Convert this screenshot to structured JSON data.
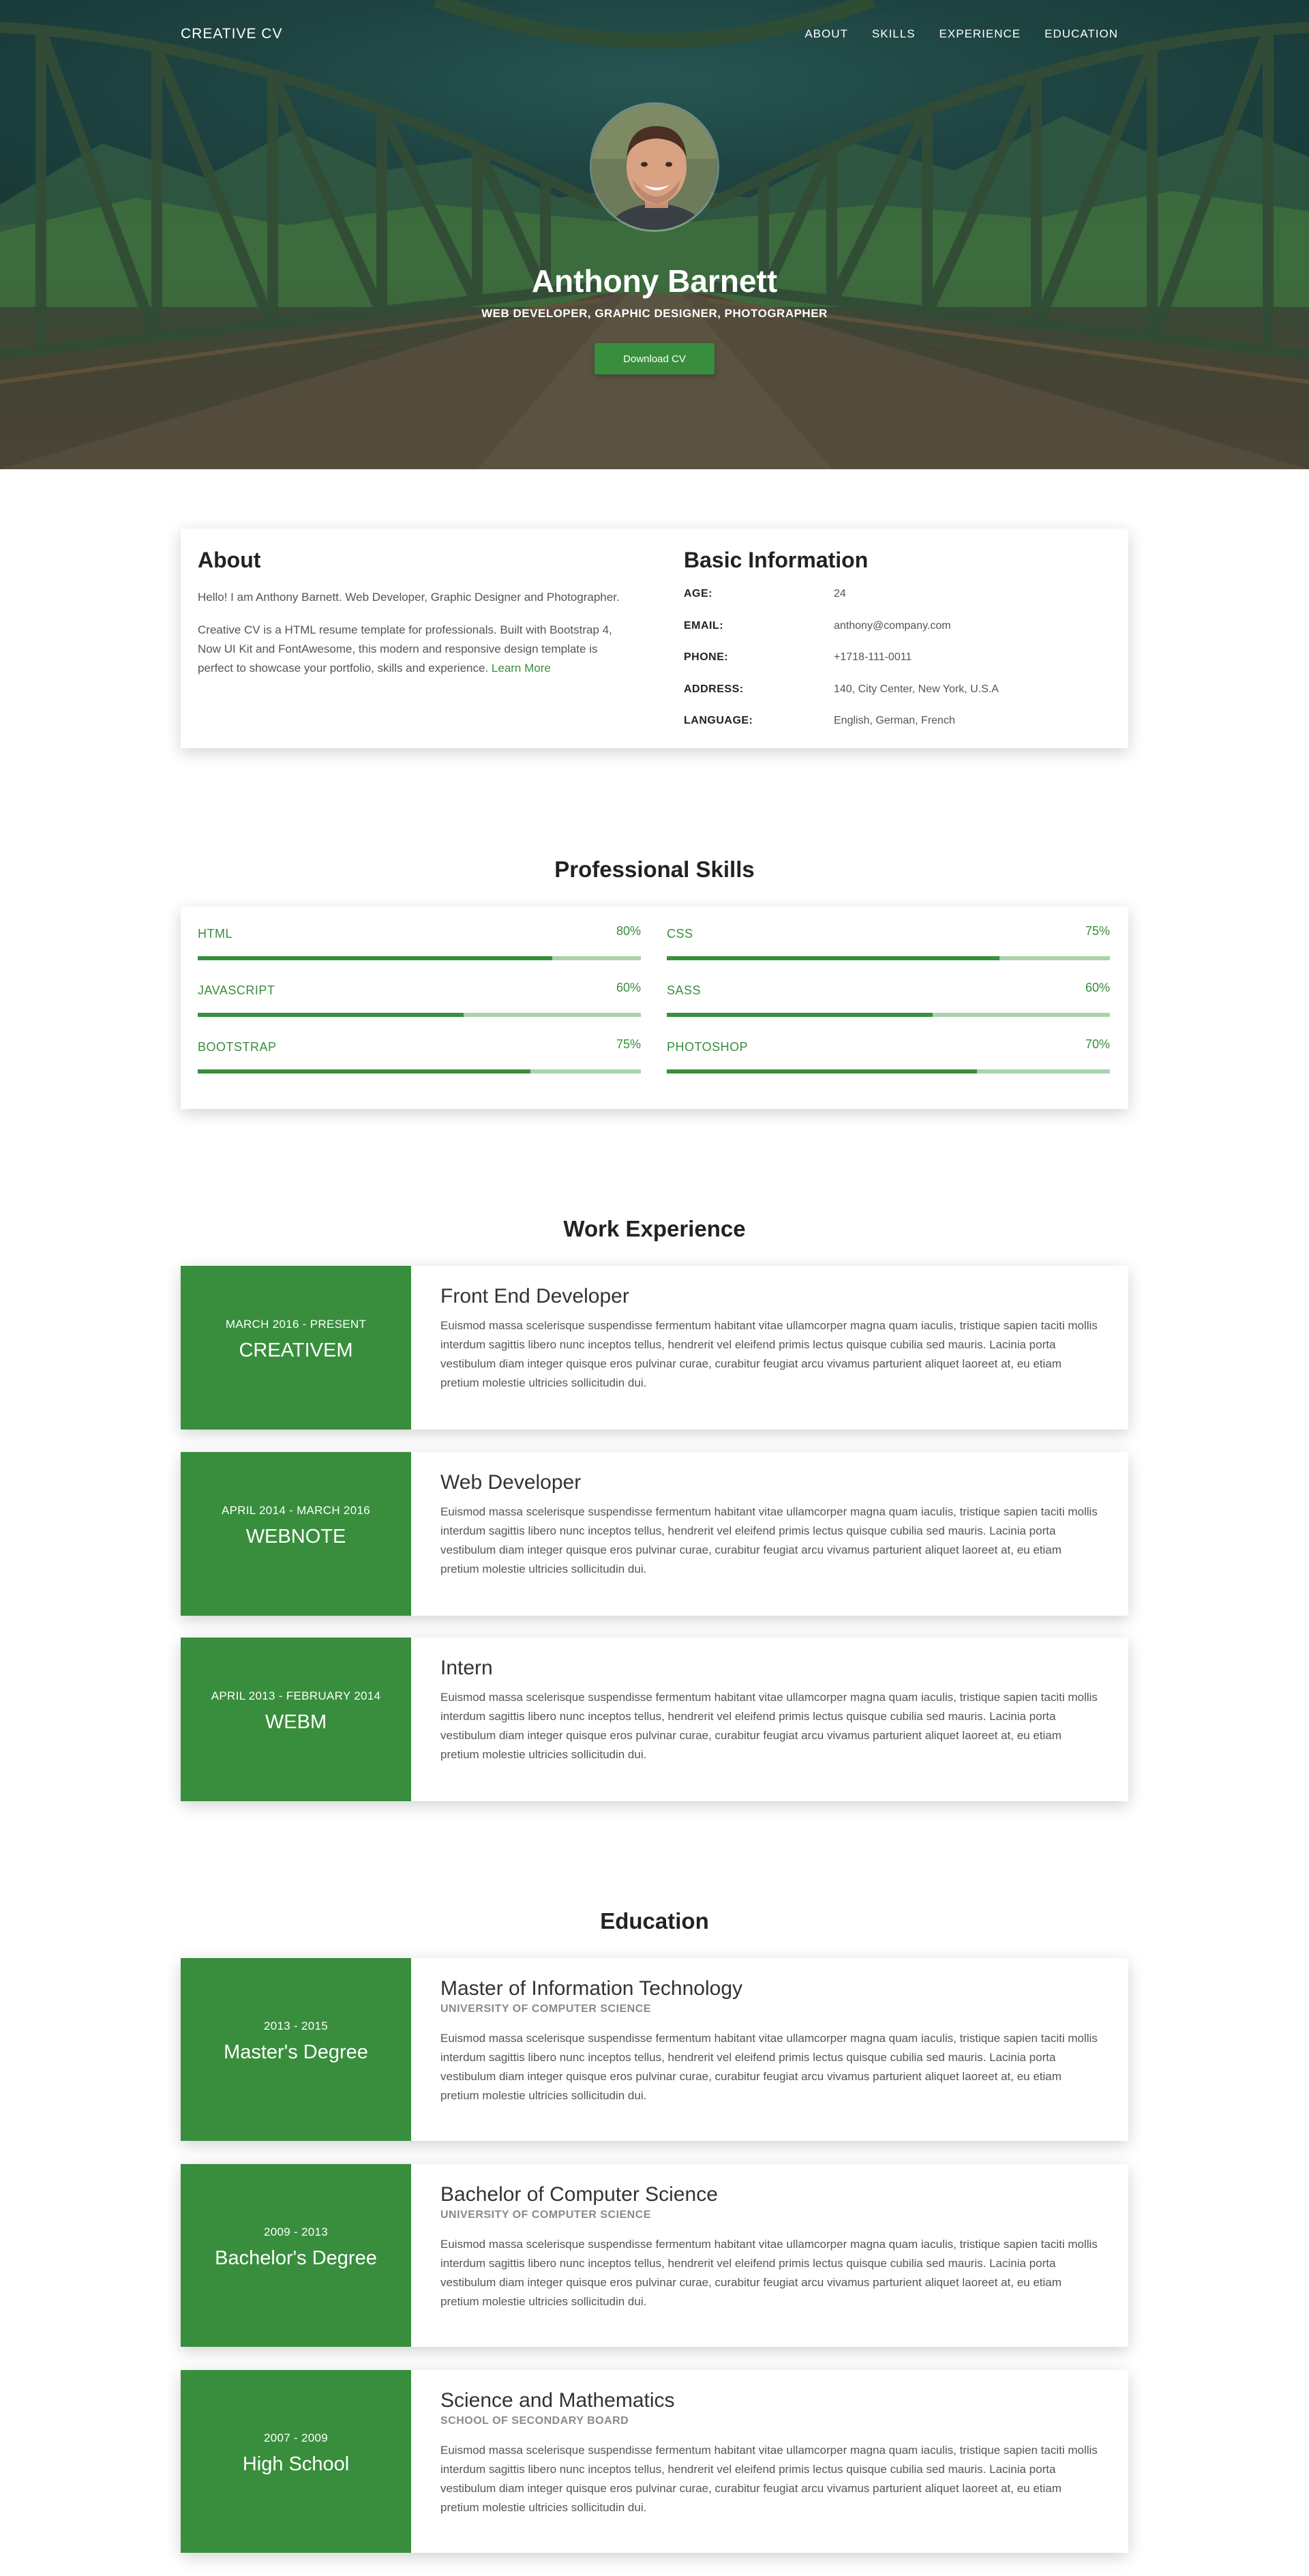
{
  "nav": {
    "brand": "CREATIVE CV",
    "links": [
      "ABOUT",
      "SKILLS",
      "EXPERIENCE",
      "EDUCATION"
    ]
  },
  "hero": {
    "name": "Anthony Barnett",
    "subtitle": "WEB DEVELOPER, GRAPHIC DESIGNER, PHOTOGRAPHER",
    "download_label": "Download CV"
  },
  "about": {
    "title": "About",
    "p1": "Hello! I am Anthony Barnett. Web Developer, Graphic Designer and Photographer.",
    "p2": "Creative CV is a HTML resume template for professionals. Built with Bootstrap 4, Now UI Kit and FontAwesome, this modern and responsive design template is perfect to showcase your portfolio, skills and experience.",
    "learn_more": "Learn More"
  },
  "basic_info": {
    "title": "Basic Information",
    "rows": [
      {
        "label": "AGE:",
        "value": "24"
      },
      {
        "label": "EMAIL:",
        "value": "anthony@company.com"
      },
      {
        "label": "PHONE:",
        "value": "+1718-111-0011"
      },
      {
        "label": "ADDRESS:",
        "value": "140, City Center, New York, U.S.A"
      },
      {
        "label": "LANGUAGE:",
        "value": "English, German, French"
      }
    ]
  },
  "skills": {
    "title": "Professional Skills",
    "items": [
      {
        "name": "HTML",
        "percent_label": "80%",
        "percent": 80
      },
      {
        "name": "CSS",
        "percent_label": "75%",
        "percent": 75
      },
      {
        "name": "JAVASCRIPT",
        "percent_label": "60%",
        "percent": 60
      },
      {
        "name": "SASS",
        "percent_label": "60%",
        "percent": 60
      },
      {
        "name": "BOOTSTRAP",
        "percent_label": "75%",
        "percent": 75
      },
      {
        "name": "PHOTOSHOP",
        "percent_label": "70%",
        "percent": 70
      }
    ]
  },
  "experience": {
    "title": "Work Experience",
    "items": [
      {
        "dates": "MARCH 2016 - PRESENT",
        "org": "CREATIVEM",
        "role": "Front End Developer",
        "text": "Euismod massa scelerisque suspendisse fermentum habitant vitae ullamcorper magna quam iaculis, tristique sapien taciti mollis interdum sagittis libero nunc inceptos tellus, hendrerit vel eleifend primis lectus quisque cubilia sed mauris. Lacinia porta vestibulum diam integer quisque eros pulvinar curae, curabitur feugiat arcu vivamus parturient aliquet laoreet at, eu etiam pretium molestie ultricies sollicitudin dui."
      },
      {
        "dates": "APRIL 2014 - MARCH 2016",
        "org": "WEBNOTE",
        "role": "Web Developer",
        "text": "Euismod massa scelerisque suspendisse fermentum habitant vitae ullamcorper magna quam iaculis, tristique sapien taciti mollis interdum sagittis libero nunc inceptos tellus, hendrerit vel eleifend primis lectus quisque cubilia sed mauris. Lacinia porta vestibulum diam integer quisque eros pulvinar curae, curabitur feugiat arcu vivamus parturient aliquet laoreet at, eu etiam pretium molestie ultricies sollicitudin dui."
      },
      {
        "dates": "APRIL 2013 - FEBRUARY 2014",
        "org": "WEBM",
        "role": "Intern",
        "text": "Euismod massa scelerisque suspendisse fermentum habitant vitae ullamcorper magna quam iaculis, tristique sapien taciti mollis interdum sagittis libero nunc inceptos tellus, hendrerit vel eleifend primis lectus quisque cubilia sed mauris. Lacinia porta vestibulum diam integer quisque eros pulvinar curae, curabitur feugiat arcu vivamus parturient aliquet laoreet at, eu etiam pretium molestie ultricies sollicitudin dui."
      }
    ]
  },
  "education": {
    "title": "Education",
    "items": [
      {
        "dates": "2013 - 2015",
        "degree": "Master's Degree",
        "program": "Master of Information Technology",
        "school": "UNIVERSITY OF COMPUTER SCIENCE",
        "text": "Euismod massa scelerisque suspendisse fermentum habitant vitae ullamcorper magna quam iaculis, tristique sapien taciti mollis interdum sagittis libero nunc inceptos tellus, hendrerit vel eleifend primis lectus quisque cubilia sed mauris. Lacinia porta vestibulum diam integer quisque eros pulvinar curae, curabitur feugiat arcu vivamus parturient aliquet laoreet at, eu etiam pretium molestie ultricies sollicitudin dui."
      },
      {
        "dates": "2009 - 2013",
        "degree": "Bachelor's Degree",
        "program": "Bachelor of Computer Science",
        "school": "UNIVERSITY OF COMPUTER SCIENCE",
        "text": "Euismod massa scelerisque suspendisse fermentum habitant vitae ullamcorper magna quam iaculis, tristique sapien taciti mollis interdum sagittis libero nunc inceptos tellus, hendrerit vel eleifend primis lectus quisque cubilia sed mauris. Lacinia porta vestibulum diam integer quisque eros pulvinar curae, curabitur feugiat arcu vivamus parturient aliquet laoreet at, eu etiam pretium molestie ultricies sollicitudin dui."
      },
      {
        "dates": "2007 - 2009",
        "degree": "High School",
        "program": "Science and Mathematics",
        "school": "SCHOOL OF SECONDARY BOARD",
        "text": "Euismod massa scelerisque suspendisse fermentum habitant vitae ullamcorper magna quam iaculis, tristique sapien taciti mollis interdum sagittis libero nunc inceptos tellus, hendrerit vel eleifend primis lectus quisque cubilia sed mauris. Lacinia porta vestibulum diam integer quisque eros pulvinar curae, curabitur feugiat arcu vivamus parturient aliquet laoreet at, eu etiam pretium molestie ultricies sollicitudin dui."
      }
    ]
  },
  "colors": {
    "accent": "#388e3c",
    "accent_light": "#a9d3aa"
  }
}
